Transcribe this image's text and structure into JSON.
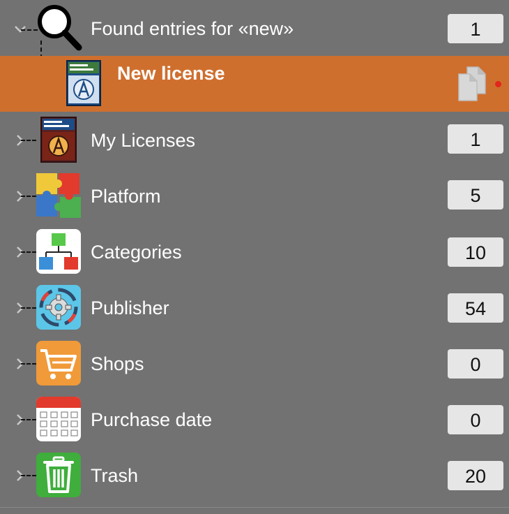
{
  "search": {
    "label": "Found entries for «new»",
    "count": "1"
  },
  "selected": {
    "label": "New license"
  },
  "items": [
    {
      "label": "My Licenses",
      "count": "1"
    },
    {
      "label": "Platform",
      "count": "5"
    },
    {
      "label": "Categories",
      "count": "10"
    },
    {
      "label": "Publisher",
      "count": "54"
    },
    {
      "label": "Shops",
      "count": "0"
    },
    {
      "label": "Purchase date",
      "count": "0"
    },
    {
      "label": "Trash",
      "count": "20"
    }
  ],
  "icons": [
    "magnifier-icon",
    "license-box-icon",
    "license-box-icon",
    "puzzle-icon",
    "tree-icon",
    "gear-icon",
    "cart-icon",
    "calendar-icon",
    "trash-icon"
  ],
  "colors": {
    "background": "#727272",
    "selection": "#cf6f2e",
    "badge": "#e6e6e6"
  }
}
